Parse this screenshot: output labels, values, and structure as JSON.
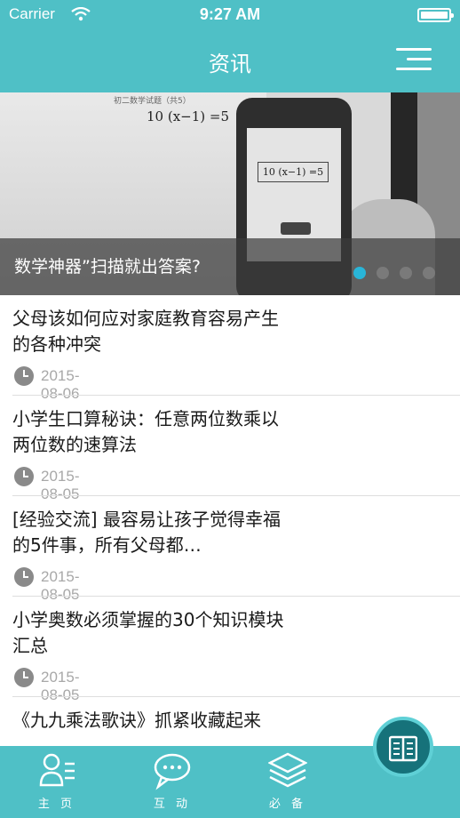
{
  "status_bar": {
    "carrier": "Carrier",
    "time": "9:27 AM"
  },
  "nav": {
    "title": "资讯",
    "menu_icon": "hamburger-menu-icon"
  },
  "banner": {
    "caption": "数学神器”扫描就出答案?",
    "image_text": {
      "paper_header": "初二数学试题（共5）",
      "equation": "10 (x−1) =5",
      "screen_equation": "10 (x−1) =5"
    },
    "page_count": 4,
    "active_page": 1
  },
  "articles": [
    {
      "title": "父母该如何应对家庭教育容易产生的各种冲突",
      "date": "2015-08-06"
    },
    {
      "title": "小学生口算秘诀：任意两位数乘以两位数的速算法",
      "date": "2015-08-05"
    },
    {
      "title": "[经验交流] 最容易让孩子觉得幸福的5件事，所有父母都…",
      "date": "2015-08-05"
    },
    {
      "title": "小学奥数必须掌握的30个知识模块汇总",
      "date": "2015-08-05"
    },
    {
      "title": "《九九乘法歌诀》抓紧收藏起来",
      "date": ""
    }
  ],
  "tabbar": {
    "tabs": [
      {
        "label": "主 页",
        "icon": "home-user-icon"
      },
      {
        "label": "互 动",
        "icon": "chat-bubble-icon"
      },
      {
        "label": "必 备",
        "icon": "layers-icon"
      }
    ],
    "active_icon": "book-icon"
  },
  "colors": {
    "primary": "#4fc0c6",
    "active_tab": "#16727a",
    "dot_active": "#29b5d8",
    "date_text": "#a8a8a8"
  }
}
